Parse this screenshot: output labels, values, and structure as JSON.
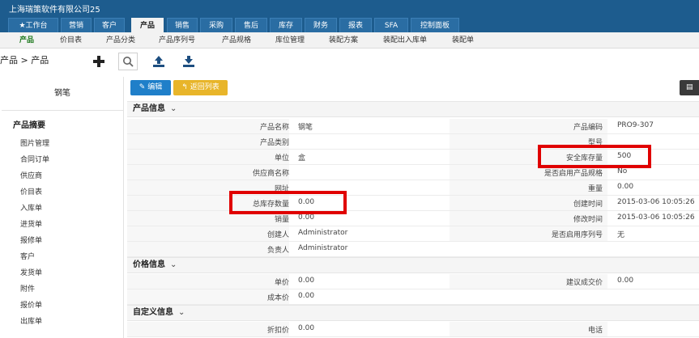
{
  "app": {
    "company": "上海瑞策软件有限公司25"
  },
  "main_nav": [
    {
      "label": "★工作台"
    },
    {
      "label": "营销"
    },
    {
      "label": "客户"
    },
    {
      "label": "产品"
    },
    {
      "label": "销售"
    },
    {
      "label": "采购"
    },
    {
      "label": "售后"
    },
    {
      "label": "库存"
    },
    {
      "label": "财务"
    },
    {
      "label": "报表"
    },
    {
      "label": "SFA"
    },
    {
      "label": "控制面板"
    }
  ],
  "sub_nav": [
    {
      "label": "产品"
    },
    {
      "label": "价目表"
    },
    {
      "label": "产品分类"
    },
    {
      "label": "产品序列号"
    },
    {
      "label": "产品规格"
    },
    {
      "label": "库位管理"
    },
    {
      "label": "装配方案"
    },
    {
      "label": "装配出入库单"
    },
    {
      "label": "装配单"
    }
  ],
  "breadcrumb": "产品 > 产品",
  "toolbar_icons": {
    "add": "+",
    "search": "search-icon",
    "upload": "upload-icon",
    "download": "download-icon"
  },
  "sidebar": {
    "title": "钢笔",
    "header": "产品摘要",
    "items": [
      "图片管理",
      "合同订单",
      "供应商",
      "价目表",
      "入库单",
      "进货单",
      "报修单",
      "客户",
      "发货单",
      "附件",
      "报价单",
      "出库单"
    ]
  },
  "actions": {
    "edit": "编辑",
    "back": "返回列表",
    "more": "▤"
  },
  "sections": {
    "product_info": "产品信息",
    "price_info": "价格信息",
    "custom_info": "自定义信息",
    "chevron": "⌄"
  },
  "product_rows": [
    {
      "l_label": "产品名称",
      "l_value": "钢笔",
      "r_label": "产品编码",
      "r_value": "PRO9-307"
    },
    {
      "l_label": "产品类别",
      "l_value": "",
      "r_label": "型号",
      "r_value": ""
    },
    {
      "l_label": "单位",
      "l_value": "盒",
      "r_label": "安全库存量",
      "r_value": "500"
    },
    {
      "l_label": "供应商名称",
      "l_value": "",
      "r_label": "是否启用产品规格",
      "r_value": "No"
    },
    {
      "l_label": "网址",
      "l_value": "",
      "r_label": "重量",
      "r_value": "0.00"
    },
    {
      "l_label": "总库存数量",
      "l_value": "0.00",
      "r_label": "创建时间",
      "r_value": "2015-03-06 10:05:26"
    },
    {
      "l_label": "销量",
      "l_value": "0.00",
      "r_label": "修改时间",
      "r_value": "2015-03-06 10:05:26"
    },
    {
      "l_label": "创建人",
      "l_value": "Administrator",
      "r_label": "是否启用序列号",
      "r_value": "无"
    },
    {
      "l_label": "负责人",
      "l_value": "Administrator",
      "r_label": "",
      "r_value": ""
    }
  ],
  "price_rows": [
    {
      "l_label": "单价",
      "l_value": "0.00",
      "r_label": "建议成交价",
      "r_value": "0.00"
    },
    {
      "l_label": "成本价",
      "l_value": "0.00",
      "r_label": "",
      "r_value": ""
    }
  ],
  "custom_rows": [
    {
      "l_label": "折扣价",
      "l_value": "0.00",
      "r_label": "电话",
      "r_value": ""
    }
  ],
  "colors": {
    "nav_bg": "#1d5c8e",
    "highlight": "#e00000",
    "edit_btn": "#1f7fc9",
    "back_btn": "#e8b52a",
    "active_sub": "#1f7a1f"
  }
}
